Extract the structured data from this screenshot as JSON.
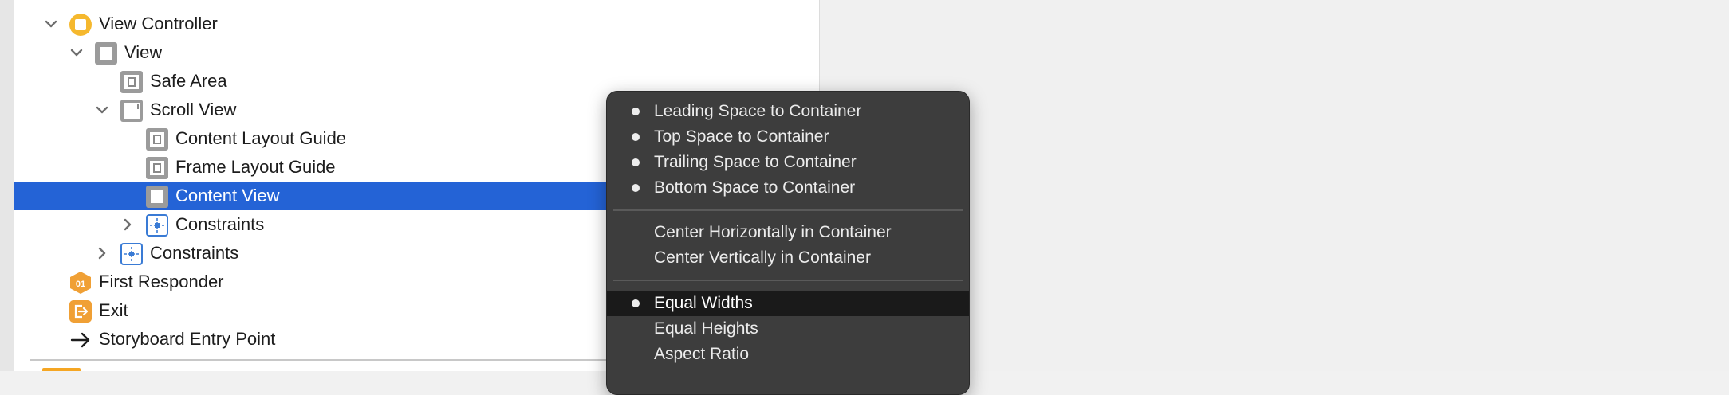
{
  "outline": {
    "items": [
      {
        "label": "View Controller",
        "icon": "view-controller-icon",
        "disclosure": "expanded"
      },
      {
        "label": "View",
        "icon": "view-icon",
        "disclosure": "expanded"
      },
      {
        "label": "Safe Area",
        "icon": "layout-guide-icon",
        "disclosure": "none"
      },
      {
        "label": "Scroll View",
        "icon": "scroll-view-icon",
        "disclosure": "expanded"
      },
      {
        "label": "Content Layout Guide",
        "icon": "layout-guide-icon",
        "disclosure": "none"
      },
      {
        "label": "Frame Layout Guide",
        "icon": "layout-guide-icon",
        "disclosure": "none"
      },
      {
        "label": "Content View",
        "icon": "view-icon",
        "disclosure": "none",
        "selected": true
      },
      {
        "label": "Constraints",
        "icon": "constraints-icon",
        "disclosure": "collapsed"
      },
      {
        "label": "Constraints",
        "icon": "constraints-icon",
        "disclosure": "collapsed"
      },
      {
        "label": "First Responder",
        "icon": "first-responder-icon",
        "disclosure": "none"
      },
      {
        "label": "Exit",
        "icon": "exit-icon",
        "disclosure": "none"
      },
      {
        "label": "Storyboard Entry Point",
        "icon": "arrow-right-icon",
        "disclosure": "none"
      }
    ]
  },
  "menu": {
    "items": [
      {
        "label": "Leading Space to Container",
        "bullet": true
      },
      {
        "label": "Top Space to Container",
        "bullet": true
      },
      {
        "label": "Trailing Space to Container",
        "bullet": true
      },
      {
        "label": "Bottom Space to Container",
        "bullet": true
      },
      {
        "label": "Center Horizontally in Container",
        "bullet": false
      },
      {
        "label": "Center Vertically in Container",
        "bullet": false
      },
      {
        "label": "Equal Widths",
        "bullet": true,
        "highlighted": true
      },
      {
        "label": "Equal Heights",
        "bullet": false
      },
      {
        "label": "Aspect Ratio",
        "bullet": false
      }
    ]
  },
  "colors": {
    "selection": "#2463d6",
    "menu_background": "#3d3d3d",
    "menu_highlight": "#1a1a1a",
    "icon_yellow": "#f5b82e",
    "icon_orange": "#f0a035",
    "icon_blue": "#3a7bd5"
  }
}
